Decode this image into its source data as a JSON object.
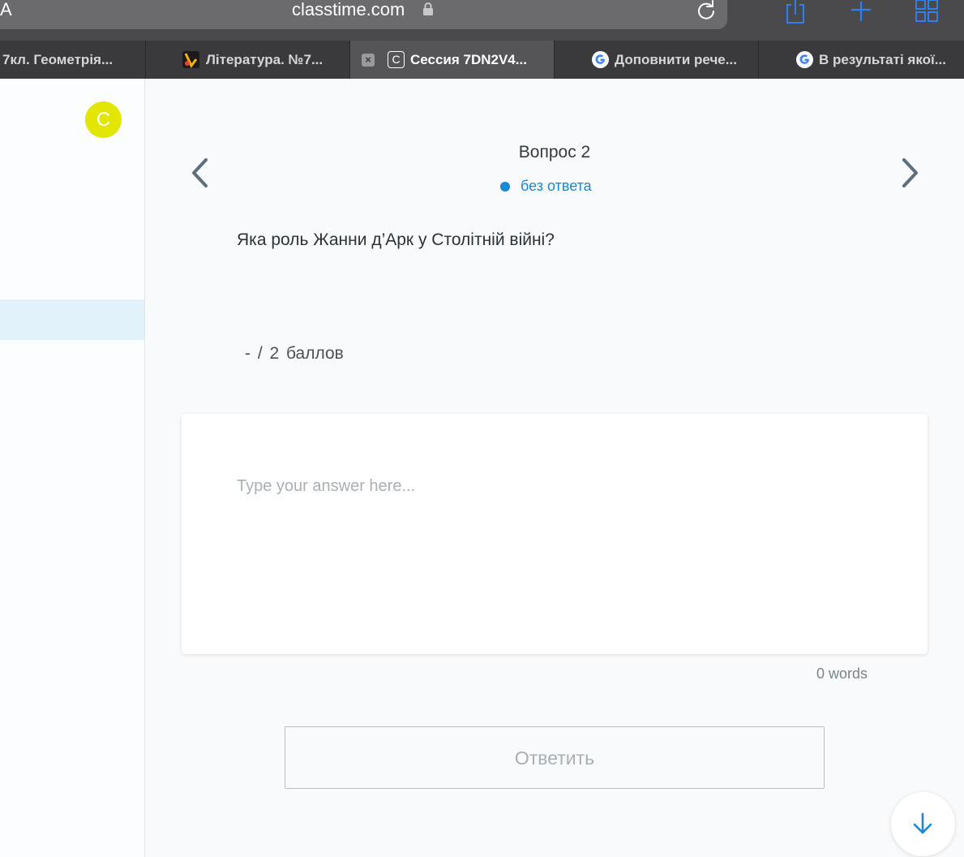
{
  "browser": {
    "text_size_label": "A",
    "url": "classtime.com",
    "tabs": [
      {
        "label": "7кл. Геометрія..."
      },
      {
        "label": "Література. №7..."
      },
      {
        "label": "Сессия 7DN2V4...",
        "favicon_letter": "C",
        "close_glyph": "×"
      },
      {
        "label": "Доповнити рече..."
      },
      {
        "label": "В результаті якої..."
      }
    ],
    "colors": {
      "toolbar_accent": "#2f7ff2"
    }
  },
  "sidebar": {
    "avatar_letter": "C",
    "avatar_color": "#e3e600"
  },
  "main": {
    "question_title": "Вопрос 2",
    "status_text": "без ответа",
    "question_text": "Яка роль Жанни д’Арк у Столітній війні?",
    "points_text": "- / 2 баллов",
    "answer_placeholder": "Type your answer here...",
    "word_count": "0 words",
    "submit_label": "Ответить",
    "accent_color": "#1c88d4"
  }
}
